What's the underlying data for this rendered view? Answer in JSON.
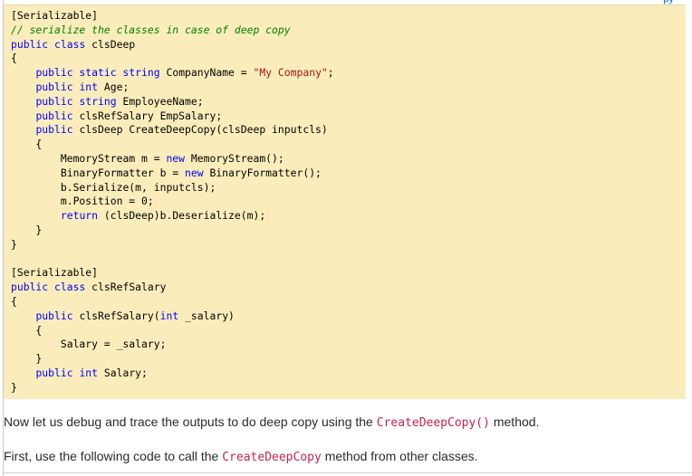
{
  "top_link": "py",
  "code_lines": [
    [
      {
        "t": "[Serializable]",
        "c": ""
      }
    ],
    [
      {
        "t": "// serialize the classes in case of deep copy",
        "c": "cm"
      }
    ],
    [
      {
        "t": "public",
        "c": "kw"
      },
      {
        "t": " ",
        "c": ""
      },
      {
        "t": "class",
        "c": "kw"
      },
      {
        "t": " clsDeep",
        "c": ""
      }
    ],
    [
      {
        "t": "{",
        "c": ""
      }
    ],
    [
      {
        "t": "    ",
        "c": ""
      },
      {
        "t": "public",
        "c": "kw"
      },
      {
        "t": " ",
        "c": ""
      },
      {
        "t": "static",
        "c": "kw"
      },
      {
        "t": " ",
        "c": ""
      },
      {
        "t": "string",
        "c": "kw"
      },
      {
        "t": " CompanyName = ",
        "c": ""
      },
      {
        "t": "\"My Company\"",
        "c": "str"
      },
      {
        "t": ";",
        "c": ""
      }
    ],
    [
      {
        "t": "    ",
        "c": ""
      },
      {
        "t": "public",
        "c": "kw"
      },
      {
        "t": " ",
        "c": ""
      },
      {
        "t": "int",
        "c": "kw"
      },
      {
        "t": " Age;",
        "c": ""
      }
    ],
    [
      {
        "t": "    ",
        "c": ""
      },
      {
        "t": "public",
        "c": "kw"
      },
      {
        "t": " ",
        "c": ""
      },
      {
        "t": "string",
        "c": "kw"
      },
      {
        "t": " EmployeeName;",
        "c": ""
      }
    ],
    [
      {
        "t": "    ",
        "c": ""
      },
      {
        "t": "public",
        "c": "kw"
      },
      {
        "t": " clsRefSalary EmpSalary;",
        "c": ""
      }
    ],
    [
      {
        "t": "    ",
        "c": ""
      },
      {
        "t": "public",
        "c": "kw"
      },
      {
        "t": " clsDeep CreateDeepCopy(clsDeep inputcls)",
        "c": ""
      }
    ],
    [
      {
        "t": "    {",
        "c": ""
      }
    ],
    [
      {
        "t": "        MemoryStream m = ",
        "c": ""
      },
      {
        "t": "new",
        "c": "kw"
      },
      {
        "t": " MemoryStream();",
        "c": ""
      }
    ],
    [
      {
        "t": "        BinaryFormatter b = ",
        "c": ""
      },
      {
        "t": "new",
        "c": "kw"
      },
      {
        "t": " BinaryFormatter();",
        "c": ""
      }
    ],
    [
      {
        "t": "        b.Serialize(m, inputcls);",
        "c": ""
      }
    ],
    [
      {
        "t": "        m.Position = 0;",
        "c": ""
      }
    ],
    [
      {
        "t": "        ",
        "c": ""
      },
      {
        "t": "return",
        "c": "kw"
      },
      {
        "t": " (clsDeep)b.Deserialize(m);",
        "c": ""
      }
    ],
    [
      {
        "t": "    }",
        "c": ""
      }
    ],
    [
      {
        "t": "}",
        "c": ""
      }
    ],
    [
      {
        "t": "",
        "c": ""
      }
    ],
    [
      {
        "t": "[Serializable]",
        "c": ""
      }
    ],
    [
      {
        "t": "public",
        "c": "kw"
      },
      {
        "t": " ",
        "c": ""
      },
      {
        "t": "class",
        "c": "kw"
      },
      {
        "t": " clsRefSalary",
        "c": ""
      }
    ],
    [
      {
        "t": "{",
        "c": ""
      }
    ],
    [
      {
        "t": "    ",
        "c": ""
      },
      {
        "t": "public",
        "c": "kw"
      },
      {
        "t": " clsRefSalary(",
        "c": ""
      },
      {
        "t": "int",
        "c": "kw"
      },
      {
        "t": " _salary)",
        "c": ""
      }
    ],
    [
      {
        "t": "    {",
        "c": ""
      }
    ],
    [
      {
        "t": "        Salary = _salary;",
        "c": ""
      }
    ],
    [
      {
        "t": "    }",
        "c": ""
      }
    ],
    [
      {
        "t": "    ",
        "c": ""
      },
      {
        "t": "public",
        "c": "kw"
      },
      {
        "t": " ",
        "c": ""
      },
      {
        "t": "int",
        "c": "kw"
      },
      {
        "t": " Salary;",
        "c": ""
      }
    ],
    [
      {
        "t": "}",
        "c": ""
      }
    ]
  ],
  "paragraph1": {
    "before": "Now let us debug and trace the outputs to do deep copy using the ",
    "code": "CreateDeepCopy()",
    "after": " method."
  },
  "paragraph2": {
    "before": "First, use the following code to call the ",
    "code": "CreateDeepCopy",
    "after": " method from other classes."
  }
}
